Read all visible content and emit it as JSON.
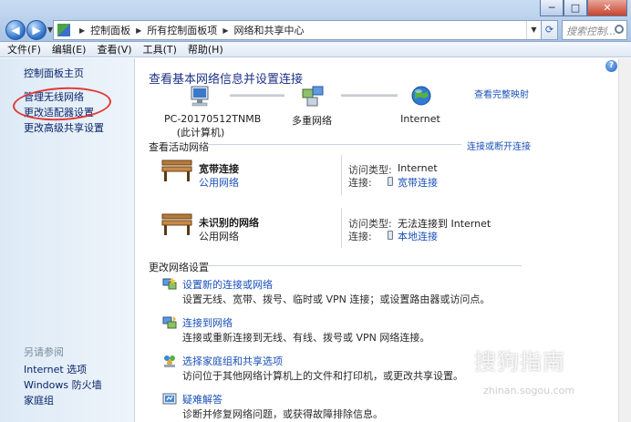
{
  "window": {
    "minimize_glyph": "─",
    "maximize_glyph": "□",
    "close_glyph": "✕"
  },
  "nav": {
    "back_glyph": "◀",
    "forward_glyph": "▶"
  },
  "address_bar": {
    "crumbs": [
      "控制面板",
      "所有控制面板项",
      "网络和共享中心"
    ]
  },
  "search": {
    "placeholder": "搜索控制..."
  },
  "menu": [
    "文件(F)",
    "编辑(E)",
    "查看(V)",
    "工具(T)",
    "帮助(H)"
  ],
  "sidebar": {
    "home": "控制面板主页",
    "links": [
      "管理无线网络",
      "更改适配器设置",
      "更改高级共享设置"
    ],
    "see_also_heading": "另请参阅",
    "see_also": [
      "Internet 选项",
      "Windows 防火墙",
      "家庭组"
    ]
  },
  "main": {
    "title": "查看基本网络信息并设置连接",
    "full_map_link": "查看完整映射",
    "map": {
      "computer_name": "PC-20170512TNMB",
      "computer_sub": "(此计算机)",
      "middle": "多重网络",
      "internet": "Internet"
    },
    "active_networks": {
      "heading": "查看活动网络",
      "connect_link": "连接或断开连接",
      "access_type_label": "访问类型:",
      "connection_label": "连接:",
      "networks": [
        {
          "name": "宽带连接",
          "type": "公用网络",
          "access_type": "Internet",
          "connection": "宽带连接"
        },
        {
          "name": "未识别的网络",
          "type": "公用网络",
          "access_type": "无法连接到 Internet",
          "connection": "本地连接"
        }
      ]
    },
    "change_settings": {
      "heading": "更改网络设置",
      "tasks": [
        {
          "title": "设置新的连接或网络",
          "desc": "设置无线、宽带、拨号、临时或 VPN 连接；或设置路由器或访问点。"
        },
        {
          "title": "连接到网络",
          "desc": "连接或重新连接到无线、有线、拨号或 VPN 网络连接。"
        },
        {
          "title": "选择家庭组和共享选项",
          "desc": "访问位于其他网络计算机上的文件和打印机，或更改共享设置。"
        },
        {
          "title": "疑难解答",
          "desc": "诊断并修复网络问题，或获得故障排除信息。"
        }
      ]
    }
  },
  "watermark": {
    "text": "搜狗指南",
    "url": "zhinan.sogou.com"
  }
}
